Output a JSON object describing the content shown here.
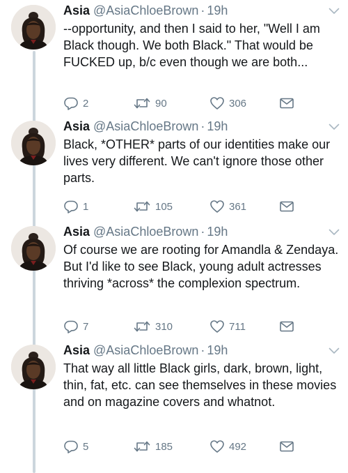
{
  "tweets": [
    {
      "name": "Asia",
      "handle": "@AsiaChloeBrown",
      "separator": "·",
      "time": "19h",
      "text": "--opportunity, and then I said to her, \"Well I am Black though. We both Black.\" That would be FUCKED up, b/c even though we are both...",
      "replies": "2",
      "retweets": "90",
      "likes": "306"
    },
    {
      "name": "Asia",
      "handle": "@AsiaChloeBrown",
      "separator": "·",
      "time": "19h",
      "text": "Black, *OTHER* parts of our identities make our lives very different. We can't ignore those other parts.",
      "replies": "1",
      "retweets": "105",
      "likes": "361"
    },
    {
      "name": "Asia",
      "handle": "@AsiaChloeBrown",
      "separator": "·",
      "time": "19h",
      "text": "Of course we are rooting for Amandla & Zendaya. But I'd like to see Black, young adult actresses thriving *across* the complexion spectrum.",
      "replies": "7",
      "retweets": "310",
      "likes": "711"
    },
    {
      "name": "Asia",
      "handle": "@AsiaChloeBrown",
      "separator": "·",
      "time": "19h",
      "text": "That way all little Black girls, dark, brown, light, thin, fat, etc. can see themselves in these movies and on magazine covers and whatnot.",
      "replies": "5",
      "retweets": "185",
      "likes": "492"
    }
  ],
  "icons": {
    "reply": "reply-icon",
    "retweet": "retweet-icon",
    "like": "heart-icon",
    "dm": "envelope-icon",
    "more": "chevron-down-icon"
  },
  "colors": {
    "text": "#14171a",
    "muted": "#657786",
    "thread_line": "#ccd6dd",
    "background": "#ffffff"
  }
}
